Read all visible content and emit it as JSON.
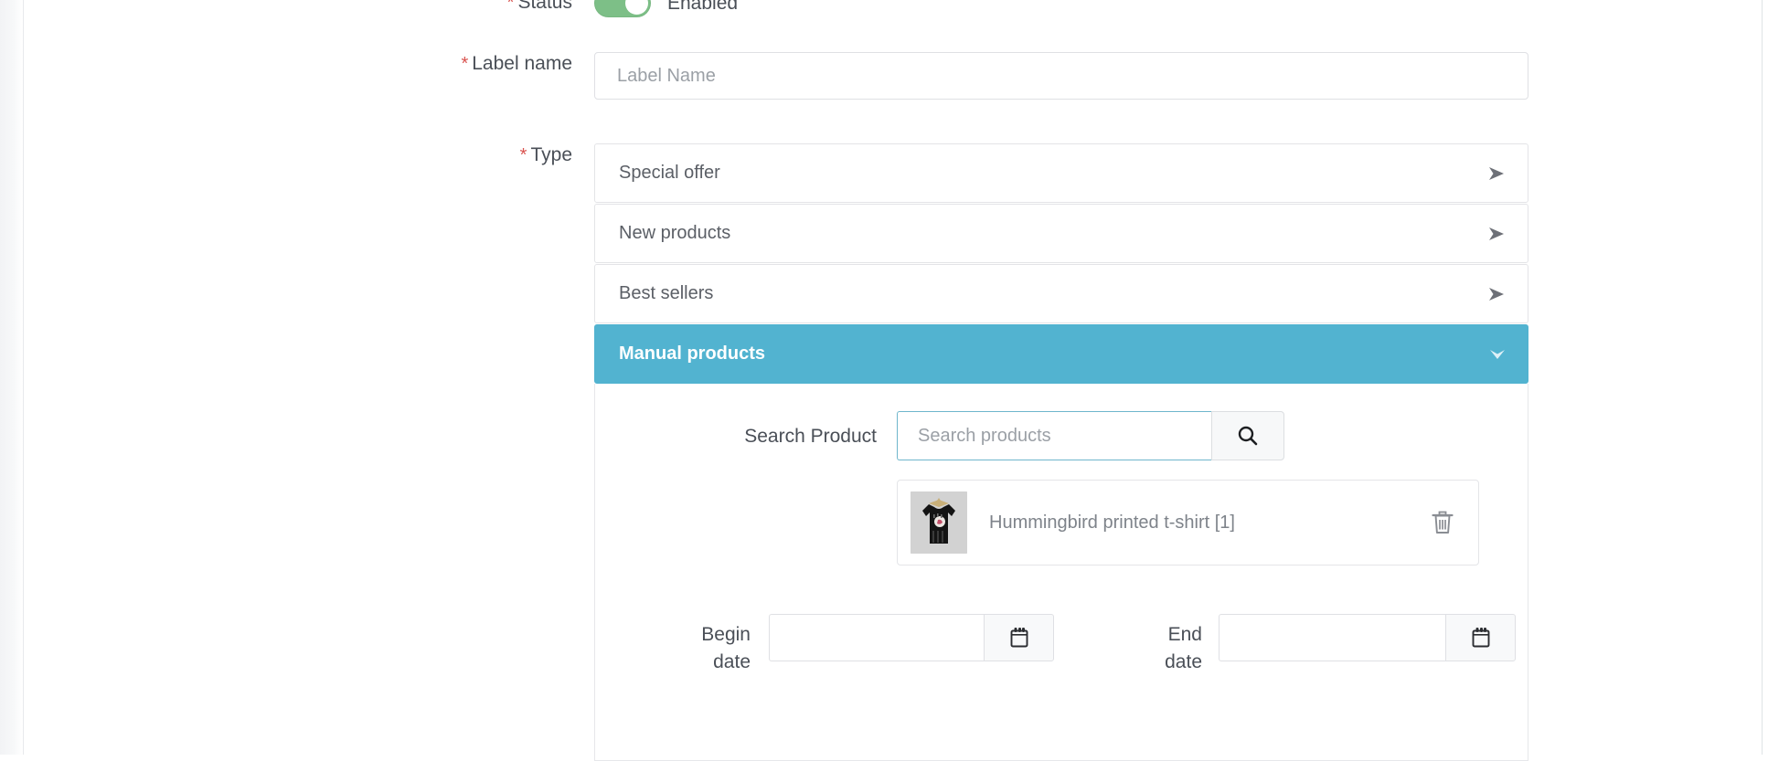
{
  "form": {
    "status": {
      "label": "Status",
      "required": true,
      "toggle_state": "on",
      "state_text": "Enabled"
    },
    "label_name": {
      "label": "Label name",
      "required": true,
      "value": "",
      "placeholder": "Label Name"
    },
    "type": {
      "label": "Type",
      "required": true,
      "options": [
        {
          "label": "Special offer",
          "active": false,
          "icon": "caret-right-icon"
        },
        {
          "label": "New products",
          "active": false,
          "icon": "caret-right-icon"
        },
        {
          "label": "Best sellers",
          "active": false,
          "icon": "caret-right-icon"
        },
        {
          "label": "Manual products",
          "active": true,
          "icon": "caret-down-icon"
        }
      ]
    },
    "manual_products_panel": {
      "search": {
        "label": "Search Product",
        "value": "",
        "placeholder": "Search products",
        "button_icon": "search-icon"
      },
      "results": [
        {
          "name": "Hummingbird printed t-shirt [1]",
          "thumbnail_alt": "black hummingbird printed t-shirt on hanger",
          "delete_icon": "trash-icon"
        }
      ],
      "begin_date": {
        "label_line1": "Begin",
        "label_line2": "date",
        "value": "",
        "placeholder": "",
        "addon_icon": "calendar-icon"
      },
      "end_date": {
        "label_line1": "End",
        "label_line2": "date",
        "value": "",
        "placeholder": "",
        "addon_icon": "calendar-icon"
      }
    }
  },
  "colors": {
    "accent_blue": "#52b3d0",
    "toggle_green": "#7dbf87",
    "required_red": "#d9534f",
    "focus_border": "#6fb6cc",
    "text": "#4a4f57",
    "muted_text": "#9ba0a6"
  }
}
